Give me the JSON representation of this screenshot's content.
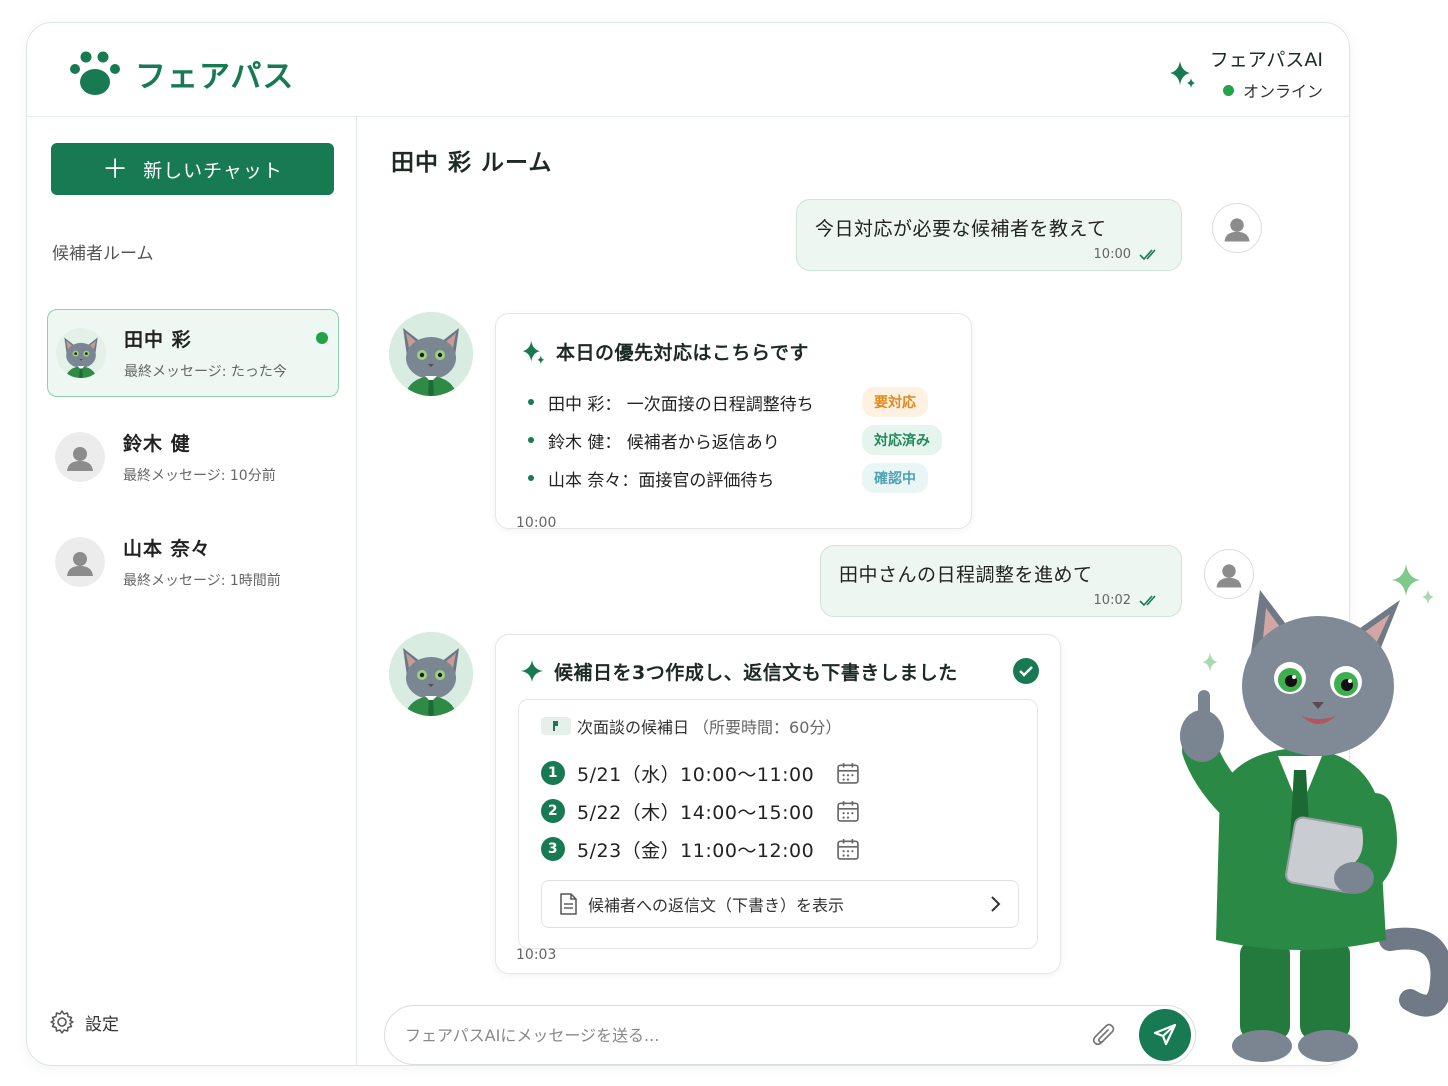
{
  "header": {
    "brand": "フェアパス",
    "ai_name": "フェアパスAI",
    "ai_status": "オンライン"
  },
  "sidebar": {
    "new_chat_label": "新しいチャット",
    "section_label": "候補者ルーム",
    "rooms": [
      {
        "name": "田中 彩",
        "last": "最終メッセージ: たった今",
        "active": true
      },
      {
        "name": "鈴木 健",
        "last": "最終メッセージ: 10分前"
      },
      {
        "name": "山本 奈々",
        "last": "最終メッセージ: 1時間前"
      }
    ],
    "settings_label": "設定"
  },
  "chat": {
    "room_title": "田中 彩 ルーム",
    "messages": [
      {
        "text": "今日対応が必要な候補者を教えて",
        "time": "10:00"
      },
      {
        "title": "本日の優先対応はこちらです",
        "items": [
          {
            "text": "田中 彩： 一次面接の日程調整待ち",
            "badge": "要対応"
          },
          {
            "text": "鈴木 健： 候補者から返信あり",
            "badge": "対応済み"
          },
          {
            "text": "山本 奈々：面接官の評価待ち",
            "badge": "確認中"
          }
        ],
        "time": "10:00"
      },
      {
        "text": "田中さんの日程調整を進めて",
        "time": "10:02"
      },
      {
        "title": "候補日を3つ作成し、返信文も下書きしました",
        "schedule_head": "次面談の候補日",
        "schedule_sub": "（所要時間：60分）",
        "slots": [
          {
            "num": "1",
            "text": "5/21（水）10:00〜11:00"
          },
          {
            "num": "2",
            "text": "5/22（木）14:00〜15:00"
          },
          {
            "num": "3",
            "text": "5/23（金）11:00〜12:00"
          }
        ],
        "draft_label": "候補者への返信文（下書き）を表示",
        "time": "10:03"
      }
    ]
  },
  "composer": {
    "placeholder": "フェアパスAIにメッセージを送る..."
  },
  "colors": {
    "brand_green": "#187a53",
    "online_green": "#22a34a",
    "user_bubble": "#edf6f1",
    "badge_warn": "#e08a1e",
    "badge_done": "#1f8a58",
    "badge_check": "#4fa3b0"
  }
}
